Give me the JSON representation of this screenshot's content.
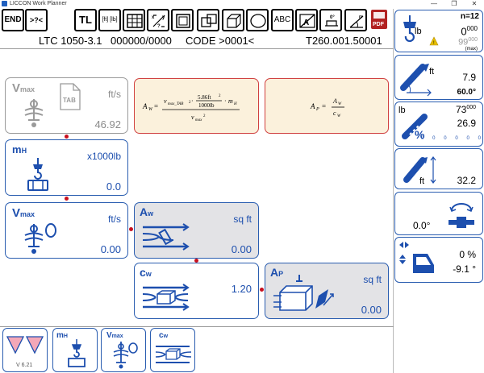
{
  "window": {
    "title": "LICCON Work Planner",
    "minimize_glyph": "—",
    "maximize_glyph": "❐",
    "close_glyph": "✕"
  },
  "toolbar": {
    "end_label": "END",
    "search_label": ">?<",
    "tl_label": "TL",
    "units_label": "[ft] [lb]",
    "abc_label": "ABC",
    "pdf_label": "PDF",
    "icons": [
      "grid-icon",
      "xy-axes-icon",
      "rect-icon",
      "overlap-rect-icon",
      "cube-icon",
      "ellipse-icon",
      "area-icon",
      "angle-icon",
      "slope-icon",
      "pdf-icon"
    ]
  },
  "info": {
    "model": "LTC 1050-3.1",
    "serial": "000000/0000",
    "code": "CODE >0001<",
    "table": "T260.001.50001"
  },
  "boxes": {
    "vmax_tab": {
      "symbol": "V",
      "sub": "max",
      "tab_label": "TAB",
      "unit": "ft/s",
      "value": "46.92"
    },
    "mh": {
      "symbol": "m",
      "sub": "H",
      "unit": "x1000lb",
      "value": "0.0"
    },
    "vmax": {
      "symbol": "V",
      "sub": "max",
      "unit": "ft/s",
      "value": "0.00"
    },
    "aw": {
      "symbol": "A",
      "sub": "w",
      "unit": "sq ft",
      "value": "0.00"
    },
    "cw": {
      "symbol": "c",
      "sub": "w",
      "value": "1.20"
    },
    "ap": {
      "symbol": "A",
      "sub": "P",
      "unit": "sq ft",
      "value": "0.00"
    }
  },
  "formulas": {
    "aw": {
      "lhs": "A",
      "lhs_sub": "W",
      "num_v": "v",
      "num_v_sub": "max_TAB",
      "num_const": "5.86ft",
      "num_const_den": "1000lb",
      "num_m": "m",
      "num_m_sub": "H",
      "den_v": "v",
      "den_v_sub": "max"
    },
    "ap": {
      "lhs": "A",
      "lhs_sub": "P",
      "num": "A",
      "num_sub": "W",
      "den": "c",
      "den_sub": "W"
    }
  },
  "right_panels": {
    "load": {
      "n_label": "n=12",
      "unit": "lb",
      "value": "0",
      "value_sup": "000",
      "max_value": "99",
      "max_sup": "000",
      "max_label": "(max)"
    },
    "radius": {
      "unit": "ft",
      "value": "7.9",
      "angle": "60.0°"
    },
    "boom": {
      "unit_top": "lb",
      "load_value": "73",
      "load_sup": "000",
      "length_value": "26.9",
      "percent_label": "%",
      "bars": [
        "0",
        "0",
        "0",
        "0",
        "0",
        "0"
      ]
    },
    "height": {
      "unit": "ft",
      "value": "32.2"
    },
    "slew": {
      "value": "0.0°"
    },
    "tilt": {
      "value1": "0 %",
      "value2": "-9.1 °"
    }
  },
  "bottom": {
    "version": "V 6.21",
    "buttons": [
      "mh-button",
      "vmax-button",
      "cw-button"
    ]
  },
  "colors": {
    "blue": "#1d4fae",
    "frame": "#2a5db0",
    "red_dot": "#c8101e",
    "formula_bg": "#fbf1dc",
    "warn": "#e8c000",
    "pink": "#f4a8b8"
  }
}
